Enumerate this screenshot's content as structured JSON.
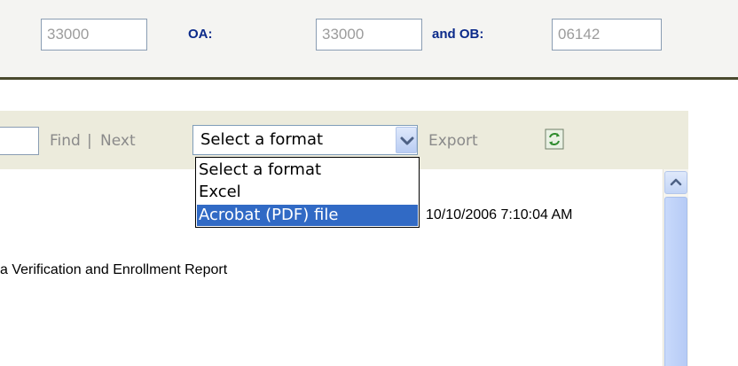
{
  "params": {
    "field1_value": "33000",
    "label_oa": "OA:",
    "field_oa_value": "33000",
    "label_ob": "and OB:",
    "field_ob_value": "06142"
  },
  "toolbar": {
    "find_label": "Find",
    "separator": "|",
    "next_label": "Next",
    "format_select_value": "Select a format",
    "export_label": "Export"
  },
  "format_options": [
    "Select a format",
    "Excel",
    "Acrobat (PDF) file"
  ],
  "report": {
    "timestamp": "10/10/2006 7:10:04 AM",
    "title": "a Verification and Enrollment Report"
  },
  "icons": {
    "refresh": "refresh-icon",
    "dropdown_arrow": "chevron-down-icon",
    "scroll_up": "chevron-up-icon"
  },
  "colors": {
    "label_blue": "#0b2a8a",
    "selection_blue": "#316ac5",
    "toolbar_bg": "#ecebdc"
  }
}
